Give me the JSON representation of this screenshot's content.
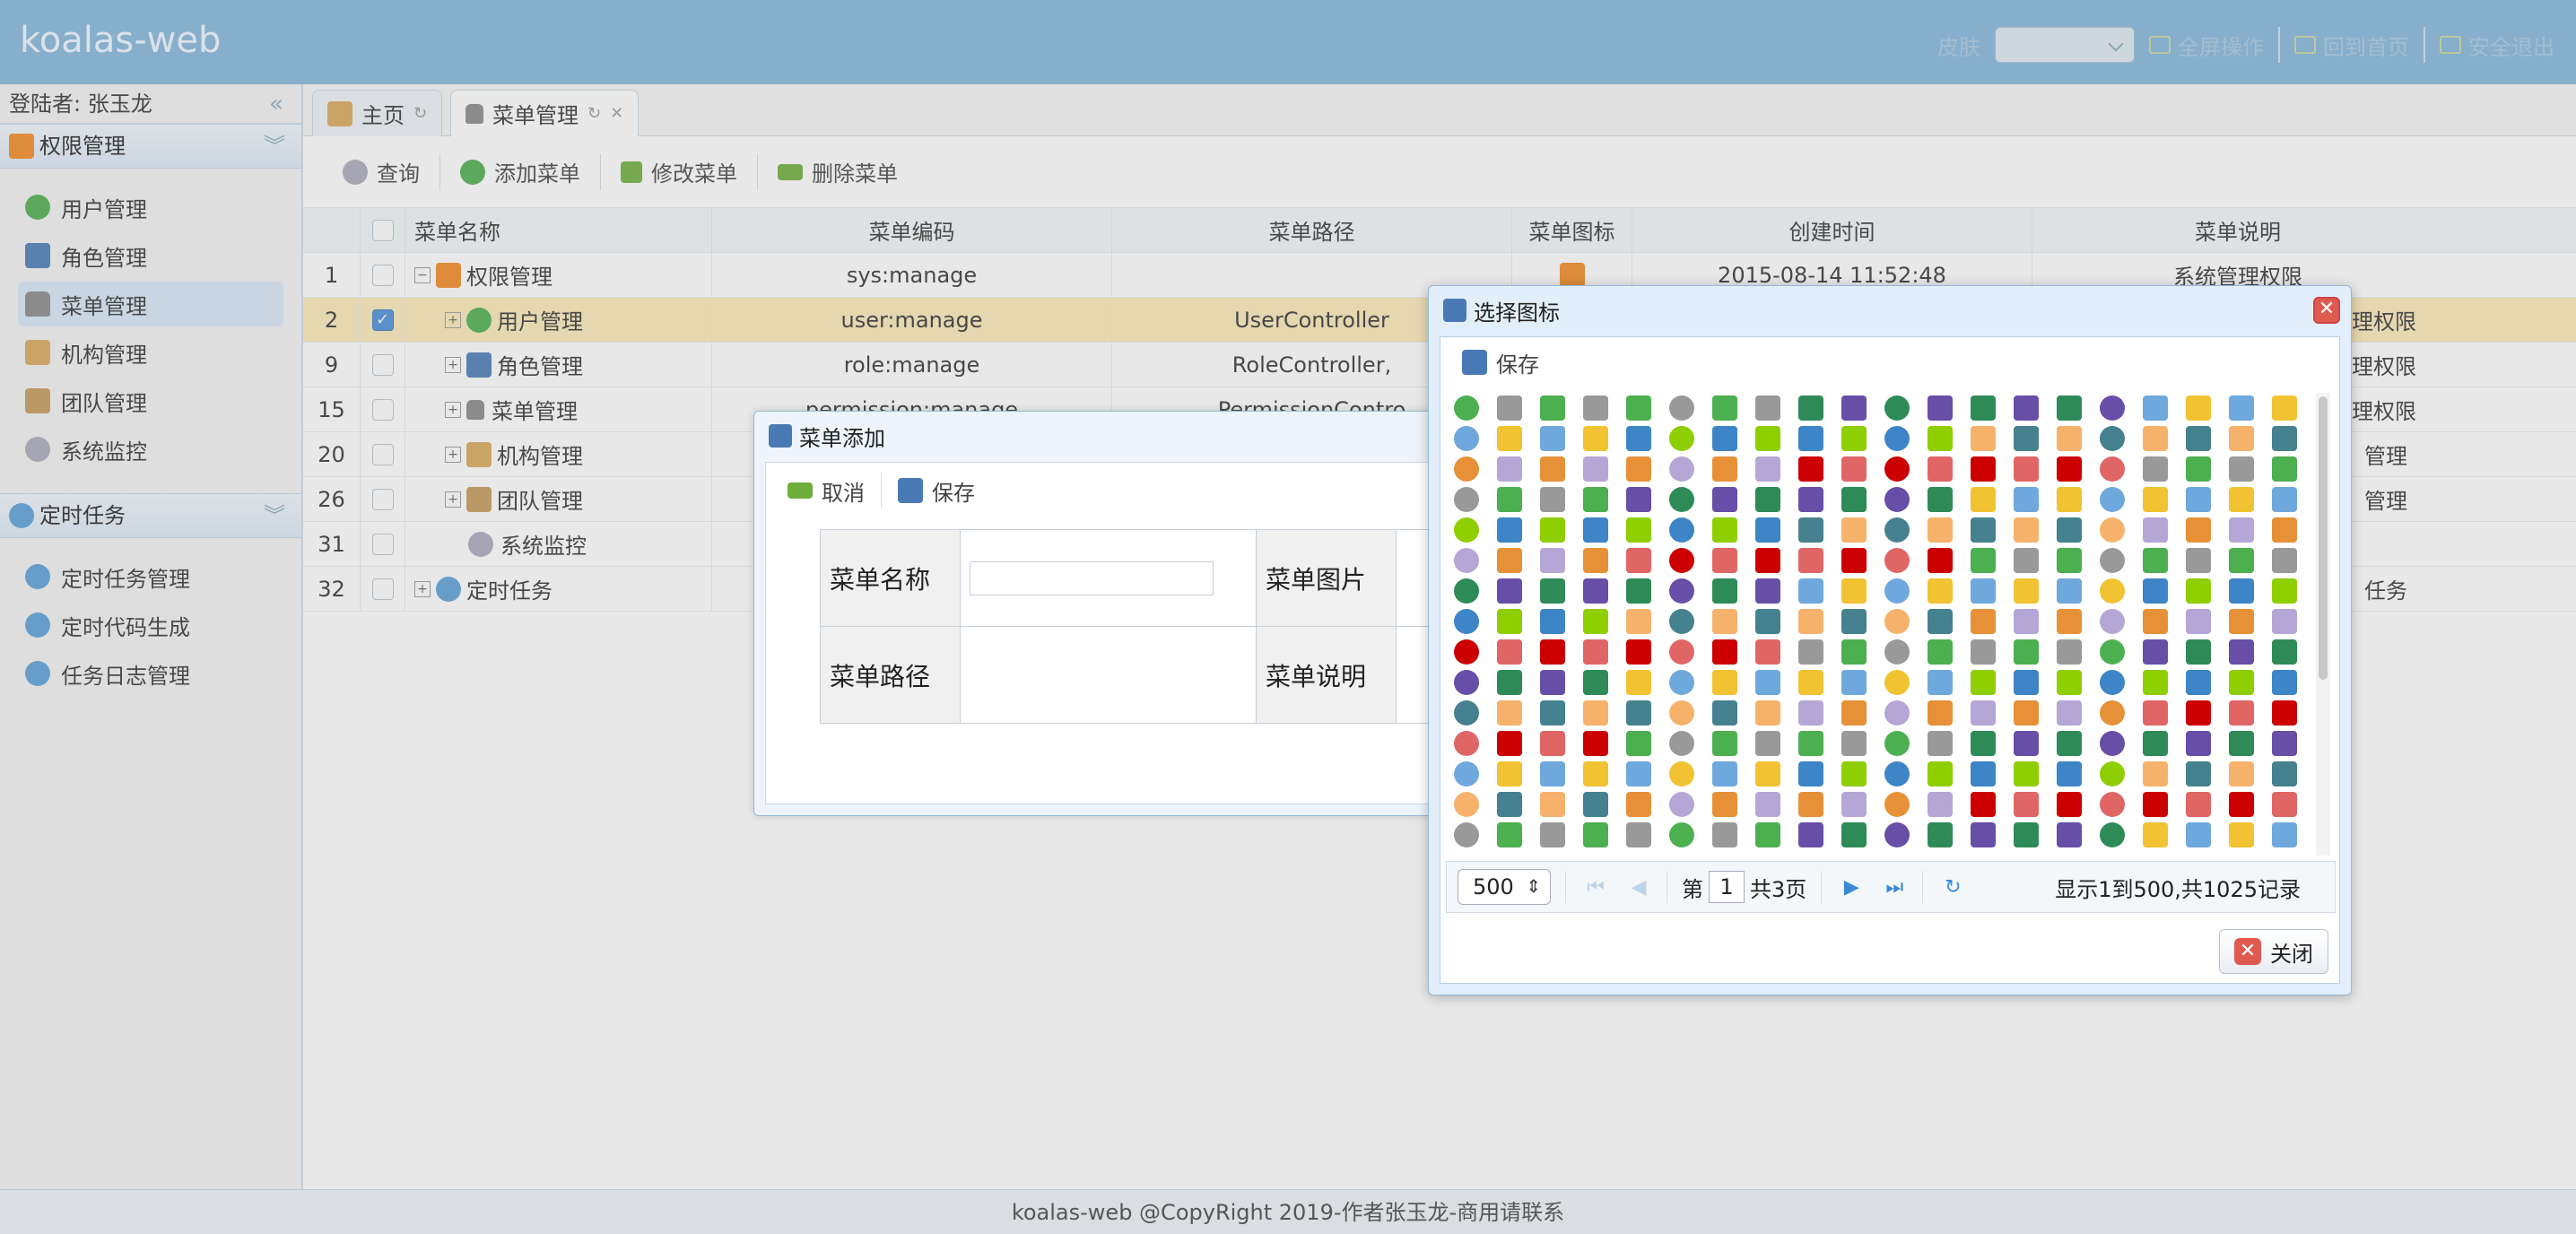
{
  "app": {
    "logo": "koalas-web",
    "skin_label": "皮肤",
    "fullscreen": "全屏操作",
    "home": "回到首页",
    "logout": "安全退出"
  },
  "sidebar": {
    "login": "登陆者: 张玉龙",
    "groups": [
      {
        "title": "权限管理",
        "items": [
          "用户管理",
          "角色管理",
          "菜单管理",
          "机构管理",
          "团队管理",
          "系统监控"
        ]
      },
      {
        "title": "定时任务",
        "items": [
          "定时任务管理",
          "定时代码生成",
          "任务日志管理"
        ]
      }
    ]
  },
  "tabs": [
    {
      "label": "主页"
    },
    {
      "label": "菜单管理"
    }
  ],
  "toolbar": {
    "query": "查询",
    "add": "添加菜单",
    "edit": "修改菜单",
    "delete": "删除菜单"
  },
  "grid": {
    "headers": [
      "菜单名称",
      "菜单编码",
      "菜单路径",
      "菜单图标",
      "创建时间",
      "菜单说明"
    ],
    "rows": [
      {
        "id": "1",
        "name": "权限管理",
        "code": "sys:manage",
        "path": "",
        "icon": "rss-icon",
        "time": "2015-08-14 11:52:48",
        "desc": "系统管理权限"
      },
      {
        "id": "2",
        "name": "用户管理",
        "code": "user:manage",
        "path": "UserController",
        "desc": "理权限"
      },
      {
        "id": "9",
        "name": "角色管理",
        "code": "role:manage",
        "path": "RoleController,",
        "desc": "理权限"
      },
      {
        "id": "15",
        "name": "菜单管理",
        "code": "permission:manage",
        "path": "PermissionContro",
        "desc": "理权限"
      },
      {
        "id": "20",
        "name": "机构管理",
        "code": "",
        "path": "",
        "desc": "管理"
      },
      {
        "id": "26",
        "name": "团队管理",
        "code": "",
        "path": "",
        "desc": "管理"
      },
      {
        "id": "31",
        "name": "系统监控",
        "code": "",
        "path": "",
        "desc": ""
      },
      {
        "id": "32",
        "name": "定时任务",
        "code": "",
        "path": "",
        "desc": "任务"
      }
    ]
  },
  "add_dialog": {
    "title": "菜单添加",
    "cancel": "取消",
    "save": "保存",
    "name_label": "菜单名称",
    "image_label": "菜单图片",
    "path_label": "菜单路径",
    "desc_label": "菜单说明",
    "name_value": ""
  },
  "icon_dialog": {
    "title": "选择图标",
    "save": "保存",
    "page_size": "500",
    "page_prefix": "第",
    "page": "1",
    "page_total": "共3页",
    "info": "显示1到500,共1025记录",
    "close": "关闭"
  },
  "footer": "koalas-web @CopyRight 2019-作者张玉龙-商用请联系"
}
